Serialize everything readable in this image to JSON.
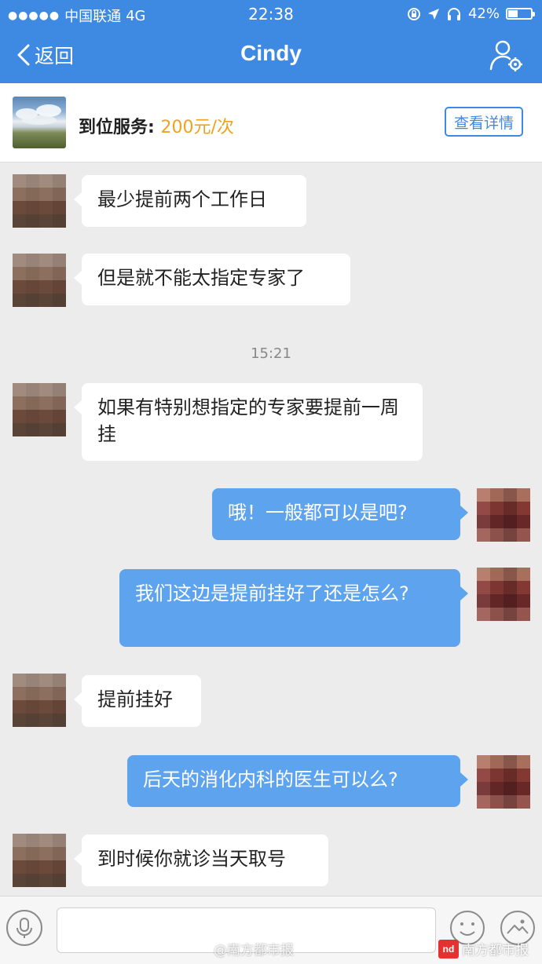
{
  "status_bar": {
    "carrier": "中国联通",
    "network": "4G",
    "time": "22:38",
    "battery": "42%",
    "battery_level": 0.42,
    "icons": [
      "signal-dots-icon",
      "lock-rotation-icon",
      "location-arrow-icon",
      "headphones-icon",
      "battery-icon"
    ]
  },
  "nav": {
    "back_label": "返回",
    "title": "Cindy",
    "profile_icon": "profile-settings-icon"
  },
  "service": {
    "label": "到位服务: ",
    "price": "200元/次",
    "detail_button": "查看详情",
    "accent_color": "#f0a21c"
  },
  "messages": [
    {
      "side": "in",
      "text": "最少提前两个工作日"
    },
    {
      "side": "in",
      "text": "但是就不能太指定专家了"
    },
    {
      "side": "in",
      "text": "如果有特别想指定的专家要提前一周挂"
    },
    {
      "side": "out",
      "text": "哦！一般都可以是吧?"
    },
    {
      "side": "out",
      "text": "我们这边是提前挂好了还是怎么?"
    },
    {
      "side": "in",
      "text": "提前挂好"
    },
    {
      "side": "out",
      "text": "后天的消化内科的医生可以么?"
    },
    {
      "side": "in",
      "text": "到时候你就诊当天取号"
    }
  ],
  "timestamp": "15:21",
  "input": {
    "placeholder": "",
    "icons": [
      "microphone-icon",
      "emoji-icon",
      "image-icon"
    ]
  },
  "watermarks": {
    "weibo": "@南方都市报",
    "logo_text": "nd",
    "brand": "南方都市报"
  },
  "colors": {
    "header": "#3e8ae3",
    "outgoing_bubble": "#5da3ee",
    "incoming_bubble": "#ffffff",
    "background": "#ececec"
  }
}
